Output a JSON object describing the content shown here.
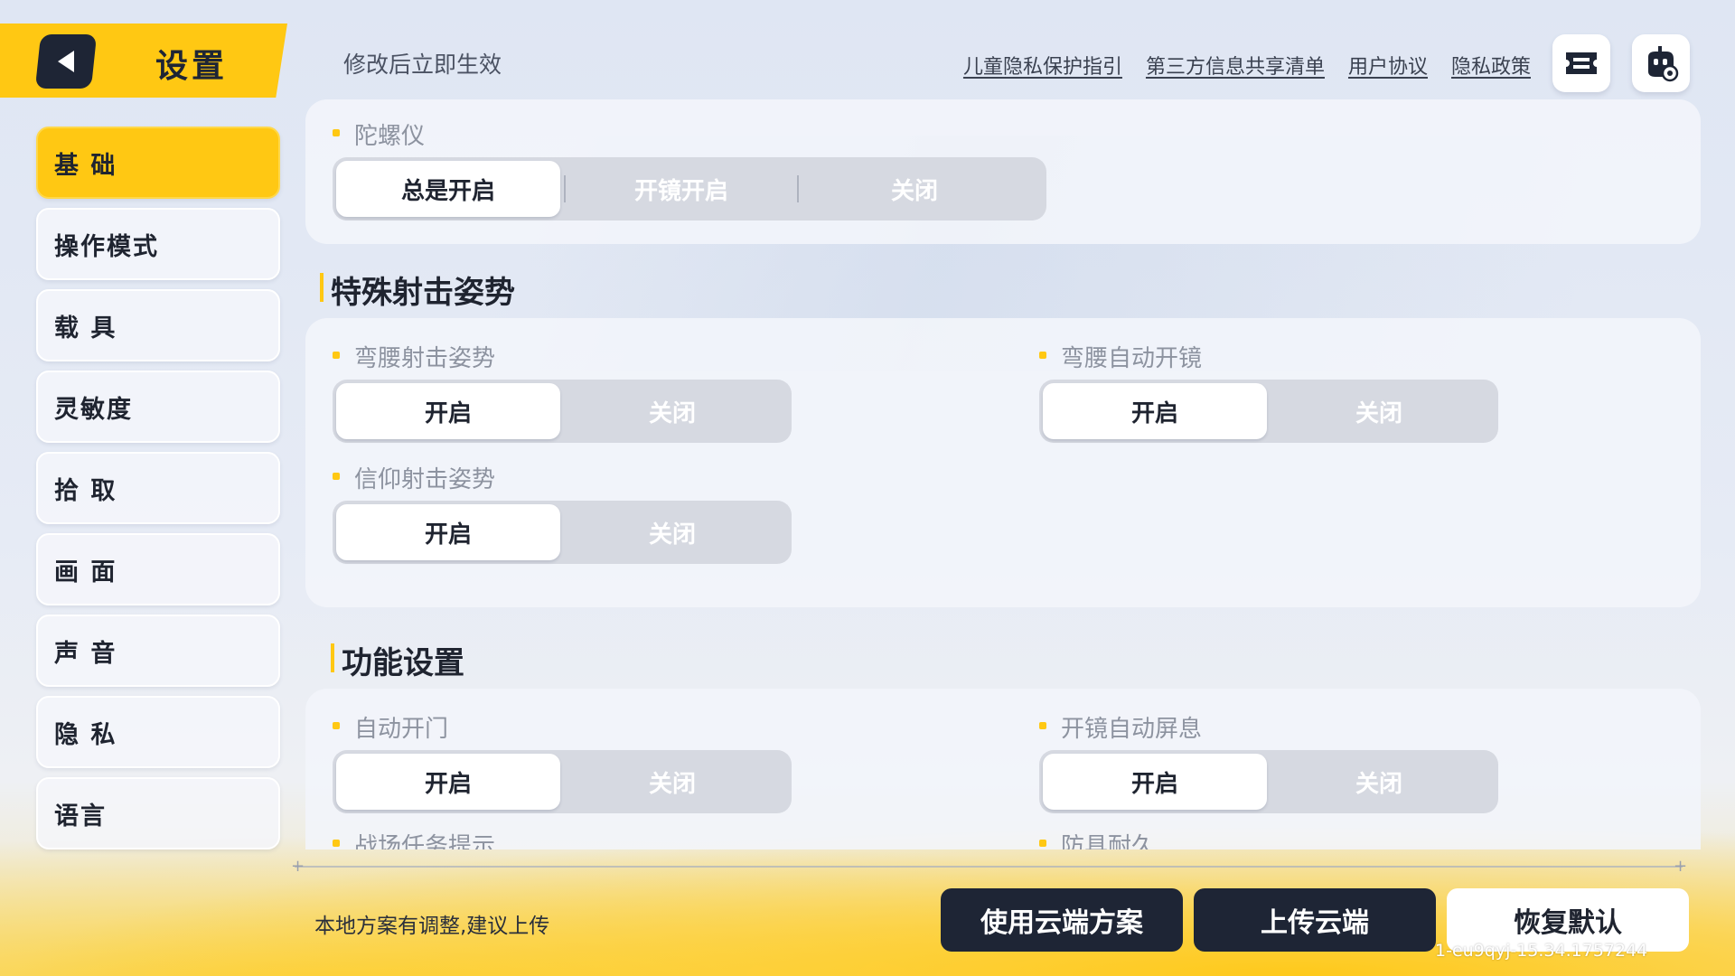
{
  "header": {
    "title": "设置",
    "hint": "修改后立即生效",
    "links": [
      "儿童隐私保护指引",
      "第三方信息共享清单",
      "用户协议",
      "隐私政策"
    ]
  },
  "sidebar": {
    "items": [
      {
        "label": "基 础",
        "active": true
      },
      {
        "label": "操作模式",
        "active": false
      },
      {
        "label": "载 具",
        "active": false
      },
      {
        "label": "灵敏度",
        "active": false
      },
      {
        "label": "拾 取",
        "active": false
      },
      {
        "label": "画 面",
        "active": false
      },
      {
        "label": "声 音",
        "active": false
      },
      {
        "label": "隐 私",
        "active": false
      },
      {
        "label": "语言",
        "active": false
      }
    ]
  },
  "gyro": {
    "label": "陀螺仪",
    "options": [
      "总是开启",
      "开镜开启",
      "关闭"
    ],
    "selected": "总是开启"
  },
  "special_stance": {
    "title": "特殊射击姿势",
    "crouch_stance": {
      "label": "弯腰射击姿势",
      "on": "开启",
      "off": "关闭",
      "selected": "开启"
    },
    "crouch_scope": {
      "label": "弯腰自动开镜",
      "on": "开启",
      "off": "关闭",
      "selected": "开启"
    },
    "faith_stance": {
      "label": "信仰射击姿势",
      "on": "开启",
      "off": "关闭",
      "selected": "开启"
    }
  },
  "function_settings": {
    "title": "功能设置",
    "auto_door": {
      "label": "自动开门",
      "on": "开启",
      "off": "关闭",
      "selected": "开启"
    },
    "scope_breath": {
      "label": "开镜自动屏息",
      "on": "开启",
      "off": "关闭",
      "selected": "开启"
    },
    "next_left": "战场任务提示",
    "next_right": "防具耐久"
  },
  "footer": {
    "upload_hint": "本地方案有调整,建议上传",
    "use_cloud": "使用云端方案",
    "upload_cloud": "上传云端",
    "restore_default": "恢复默认",
    "version": "1-eu9qyj-15.34.1757244"
  },
  "colors": {
    "accent": "#ffc813",
    "dark": "#1e2535",
    "segment_bg": "#d6d9e1"
  },
  "icons": [
    "back-arrow-icon",
    "ticket-icon",
    "robot-settings-icon"
  ]
}
